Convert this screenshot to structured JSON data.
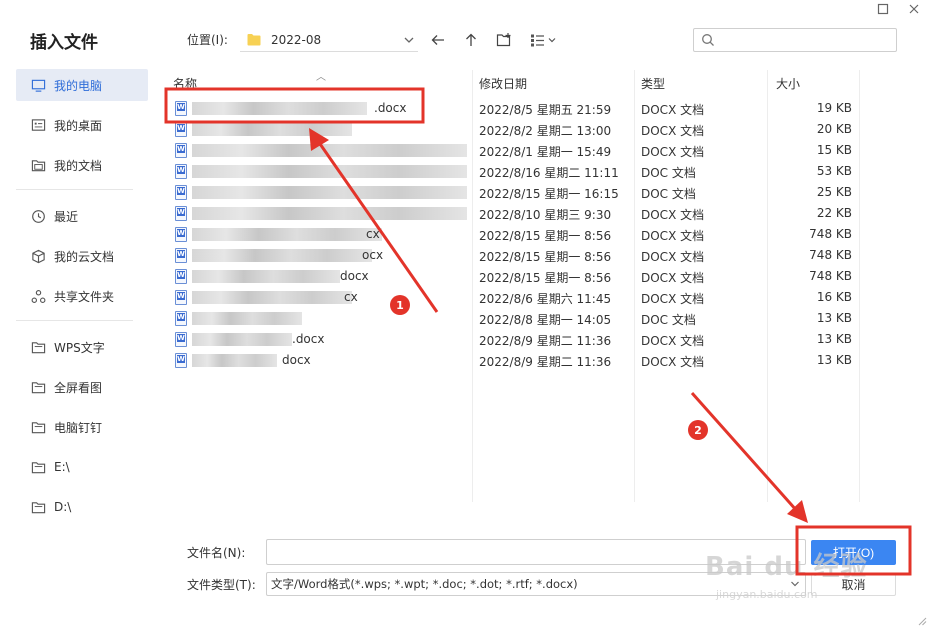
{
  "dialog": {
    "title": "插入文件",
    "window_buttons": {
      "maximize_icon": "maximize-icon",
      "close_icon": "close-icon"
    }
  },
  "sidebar": {
    "items": [
      {
        "label": "我的电脑",
        "icon": "computer-icon",
        "active": true
      },
      {
        "label": "我的桌面",
        "icon": "desktop-icon",
        "active": false
      },
      {
        "label": "我的文档",
        "icon": "documents-icon",
        "active": false
      },
      {
        "label": "最近",
        "icon": "clock-icon",
        "active": false
      },
      {
        "label": "我的云文档",
        "icon": "cloud-box-icon",
        "active": false
      },
      {
        "label": "共享文件夹",
        "icon": "share-icon",
        "active": false
      },
      {
        "label": "WPS文字",
        "icon": "folder-icon",
        "active": false
      },
      {
        "label": "全屏看图",
        "icon": "folder-icon",
        "active": false
      },
      {
        "label": "电脑钉钉",
        "icon": "folder-icon",
        "active": false
      },
      {
        "label": "E:\\",
        "icon": "folder-icon",
        "active": false
      },
      {
        "label": "D:\\",
        "icon": "folder-icon",
        "active": false
      }
    ]
  },
  "toolbar": {
    "location_label": "位置(I):",
    "location_value": "2022-08",
    "search_placeholder": ""
  },
  "file_list": {
    "headers": {
      "name": "名称",
      "modified": "修改日期",
      "type": "类型",
      "size": "大小"
    },
    "rows": [
      {
        "name_visible": ".docx",
        "modified": "2022/8/5 星期五 21:59",
        "type": "DOCX 文档",
        "size": "19 KB"
      },
      {
        "name_visible": "",
        "modified": "2022/8/2 星期二 13:00",
        "type": "DOCX 文档",
        "size": "20 KB"
      },
      {
        "name_visible": "",
        "modified": "2022/8/1 星期一 15:49",
        "type": "DOCX 文档",
        "size": "15 KB"
      },
      {
        "name_visible": "",
        "modified": "2022/8/16 星期二 11:11",
        "type": "DOC 文档",
        "size": "53 KB"
      },
      {
        "name_visible": "",
        "modified": "2022/8/15 星期一 16:15",
        "type": "DOC 文档",
        "size": "25 KB"
      },
      {
        "name_visible": "",
        "modified": "2022/8/10 星期三 9:30",
        "type": "DOCX 文档",
        "size": "22 KB"
      },
      {
        "name_visible": "cx",
        "modified": "2022/8/15 星期一 8:56",
        "type": "DOCX 文档",
        "size": "748 KB"
      },
      {
        "name_visible": "ocx",
        "modified": "2022/8/15 星期一 8:56",
        "type": "DOCX 文档",
        "size": "748 KB"
      },
      {
        "name_visible": "docx",
        "modified": "2022/8/15 星期一 8:56",
        "type": "DOCX 文档",
        "size": "748 KB"
      },
      {
        "name_visible": "cx",
        "modified": "2022/8/6 星期六 11:45",
        "type": "DOCX 文档",
        "size": "16 KB"
      },
      {
        "name_visible": "",
        "modified": "2022/8/8 星期一 14:05",
        "type": "DOC 文档",
        "size": "13 KB"
      },
      {
        "name_visible": ".docx",
        "modified": "2022/8/9 星期二 11:36",
        "type": "DOCX 文档",
        "size": "13 KB"
      },
      {
        "name_visible": "docx",
        "modified": "2022/8/9 星期二 11:36",
        "type": "DOCX 文档",
        "size": "13 KB"
      }
    ]
  },
  "bottom": {
    "filename_label": "文件名(N):",
    "filename_value": "",
    "filetype_label": "文件类型(T):",
    "filetype_value": "文字/Word格式(*.wps; *.wpt; *.doc; *.dot; *.rtf; *.docx)",
    "open_button": "打开(O)",
    "cancel_button": "取消"
  },
  "annotations": {
    "badge_1": "1",
    "badge_2": "2",
    "highlight_color": "#e3342a",
    "watermark": "Bai du 经验",
    "watermark_sub": "jingyan.baidu.com"
  },
  "colors": {
    "accent": "#3b86f2",
    "sidebar_active_bg": "#e6ebf5",
    "sidebar_active_text": "#2f6dd8"
  }
}
